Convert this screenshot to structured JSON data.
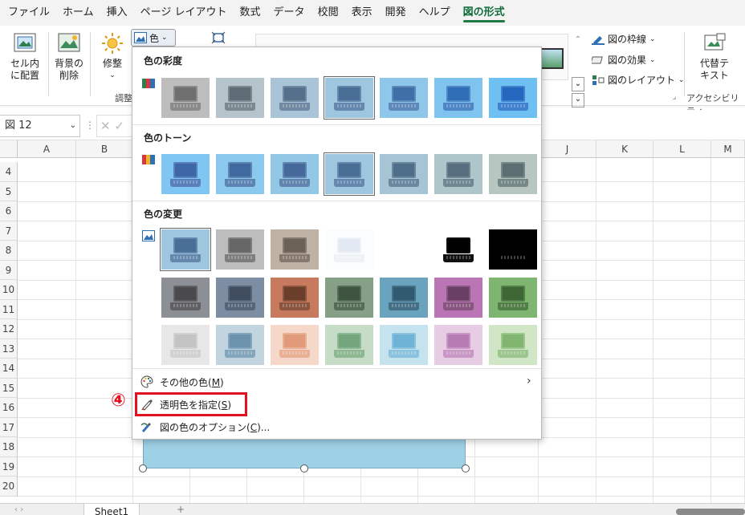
{
  "menu": {
    "items": [
      "ファイル",
      "ホーム",
      "挿入",
      "ページ レイアウト",
      "数式",
      "データ",
      "校閲",
      "表示",
      "開発",
      "ヘルプ",
      "図の形式"
    ],
    "active_index": 10
  },
  "ribbon": {
    "cell_place": "セル内\nに配置",
    "bg_remove": "背景の\n削除",
    "correct": "修整",
    "color_button": "色",
    "adjust_group": "調整",
    "picture_border": "図の枠線",
    "picture_effects": "図の効果",
    "picture_layout": "図のレイアウト",
    "alt_text": "代替テ\nキスト",
    "accessibility_group": "アクセシビリティ"
  },
  "formula_bar": {
    "name_box": "図 12"
  },
  "grid": {
    "columns": [
      "A",
      "B",
      "",
      "",
      "",
      "",
      "",
      "",
      "",
      "J",
      "K",
      "L",
      "M"
    ],
    "rows": [
      "4",
      "5",
      "6",
      "7",
      "8",
      "9",
      "10",
      "11",
      "12",
      "13",
      "14",
      "15",
      "16",
      "17",
      "18",
      "19",
      "20"
    ]
  },
  "sheet_tab": "Sheet1",
  "dropdown": {
    "saturation_title": "色の彩度",
    "tone_title": "色のトーン",
    "recolor_title": "色の変更",
    "more_colors": "その他の色(",
    "more_colors_key": "M",
    "set_transparent": "透明色を指定(",
    "set_transparent_key": "S",
    "color_options": "図の色のオプション(",
    "color_options_key": "C",
    "paren_close": ")",
    "ellipsis": "..."
  },
  "annotation": {
    "step_label": "④"
  },
  "colors": {
    "accent_green": "#1f7a45",
    "highlight_red": "#e3101e",
    "shape_fill": "#9ed0e6"
  }
}
